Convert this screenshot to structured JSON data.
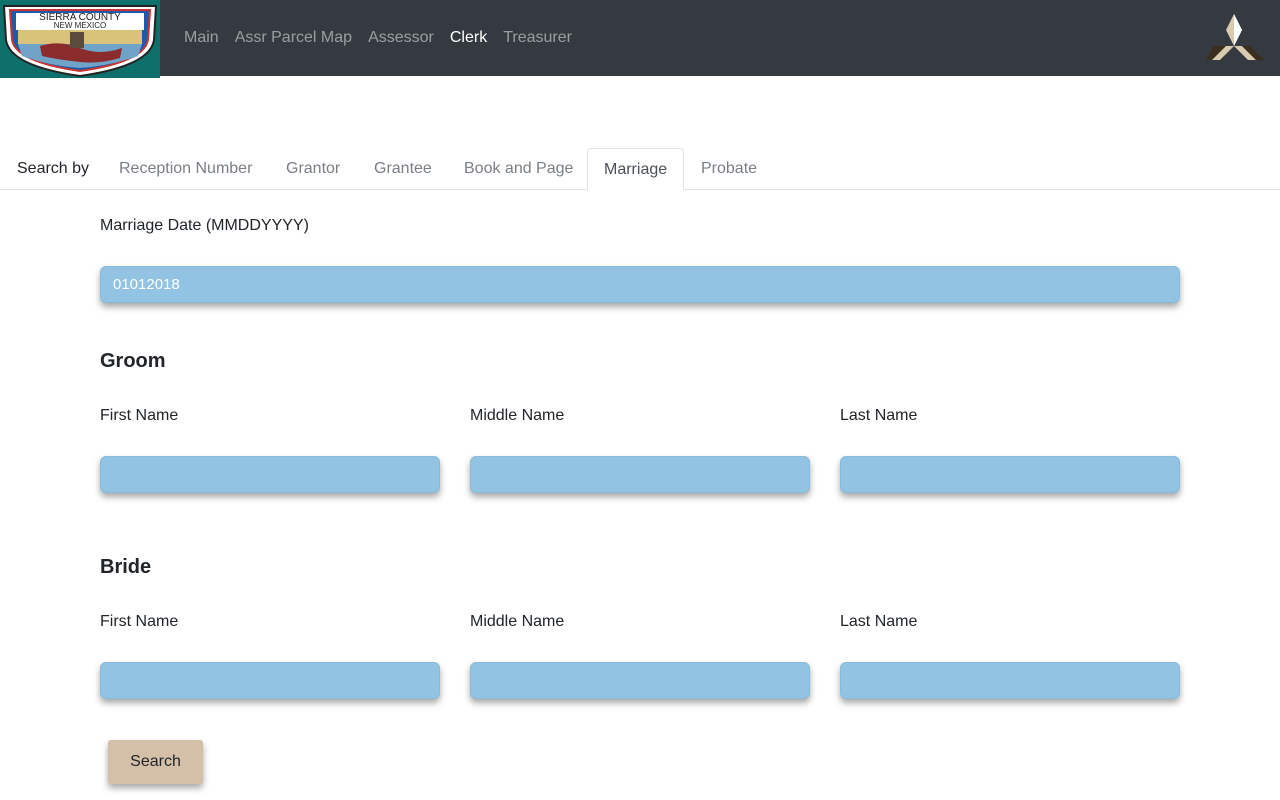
{
  "nav": {
    "logo_text_top": "SIERRA COUNTY",
    "logo_text_bottom": "NEW MEXICO",
    "links": [
      "Main",
      "Assr Parcel Map",
      "Assessor",
      "Clerk",
      "Treasurer"
    ],
    "active": "Clerk"
  },
  "tabs": {
    "label": "Search by",
    "items": [
      "Reception Number",
      "Grantor",
      "Grantee",
      "Book and Page",
      "Marriage",
      "Probate"
    ],
    "active": "Marriage"
  },
  "form": {
    "marriage_date_label": "Marriage Date (MMDDYYYY)",
    "marriage_date_value": "01012018",
    "groom": {
      "title": "Groom",
      "first_label": "First Name",
      "middle_label": "Middle Name",
      "last_label": "Last Name"
    },
    "bride": {
      "title": "Bride",
      "first_label": "First Name",
      "middle_label": "Middle Name",
      "last_label": "Last Name"
    },
    "search_label": "Search"
  },
  "colors": {
    "navbar": "#343a40",
    "logo_bg": "#0f6f6a",
    "input_bg": "#93c3e3",
    "button_bg": "#d4bfa8"
  }
}
